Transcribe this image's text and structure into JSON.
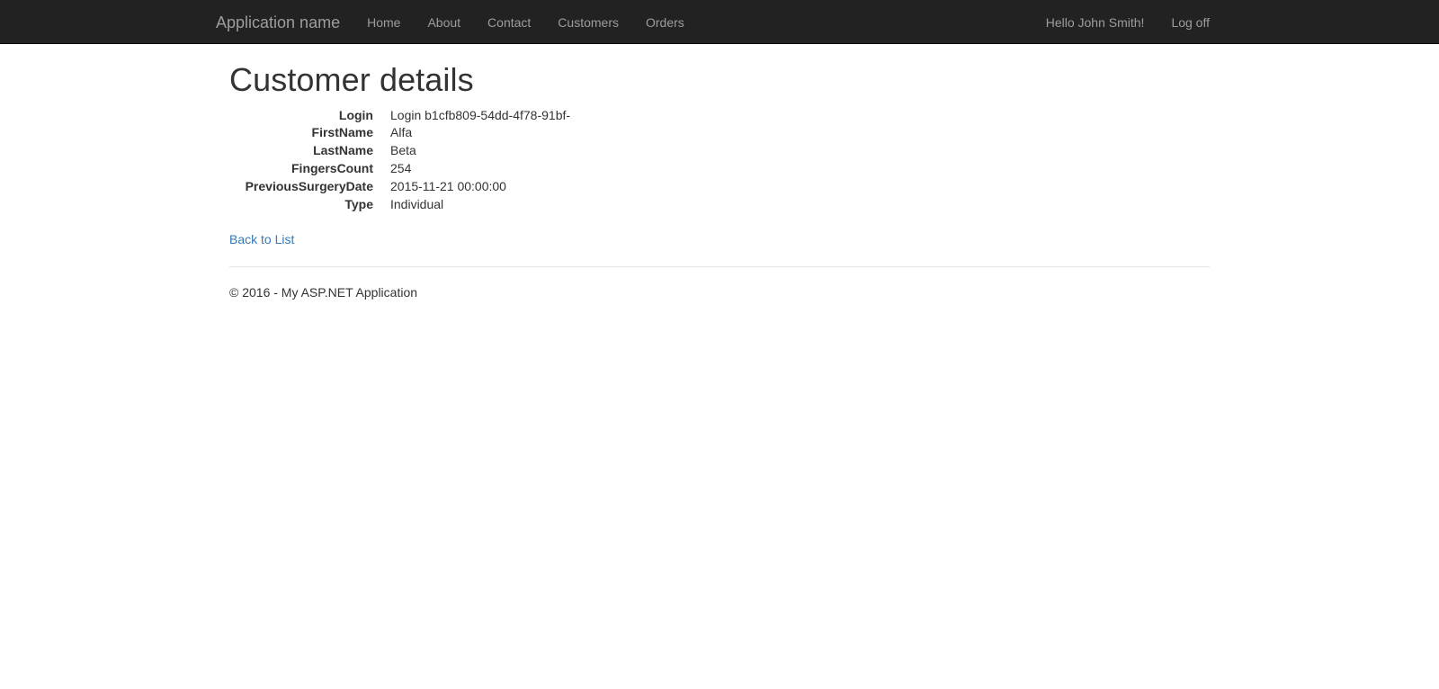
{
  "navbar": {
    "brand": "Application name",
    "links": [
      {
        "label": "Home",
        "name": "nav-link-home"
      },
      {
        "label": "About",
        "name": "nav-link-about"
      },
      {
        "label": "Contact",
        "name": "nav-link-contact"
      },
      {
        "label": "Customers",
        "name": "nav-link-customers"
      },
      {
        "label": "Orders",
        "name": "nav-link-orders"
      }
    ],
    "greeting": "Hello John Smith!",
    "logoff": "Log off"
  },
  "main": {
    "title": "Customer details",
    "details": [
      {
        "term": "Login",
        "value": "Login b1cfb809-54dd-4f78-91bf-"
      },
      {
        "term": "FirstName",
        "value": "Alfa"
      },
      {
        "term": "LastName",
        "value": "Beta"
      },
      {
        "term": "FingersCount",
        "value": "254"
      },
      {
        "term": "PreviousSurgeryDate",
        "value": "2015-11-21 00:00:00"
      },
      {
        "term": "Type",
        "value": "Individual"
      }
    ],
    "back_link": "Back to List"
  },
  "footer": {
    "copyright": "© 2016 - My ASP.NET Application"
  },
  "colors": {
    "navbar_bg": "#222222",
    "navbar_text": "#9d9d9d",
    "link": "#337ab7",
    "body_text": "#333333",
    "rule": "#e5e5e5"
  }
}
